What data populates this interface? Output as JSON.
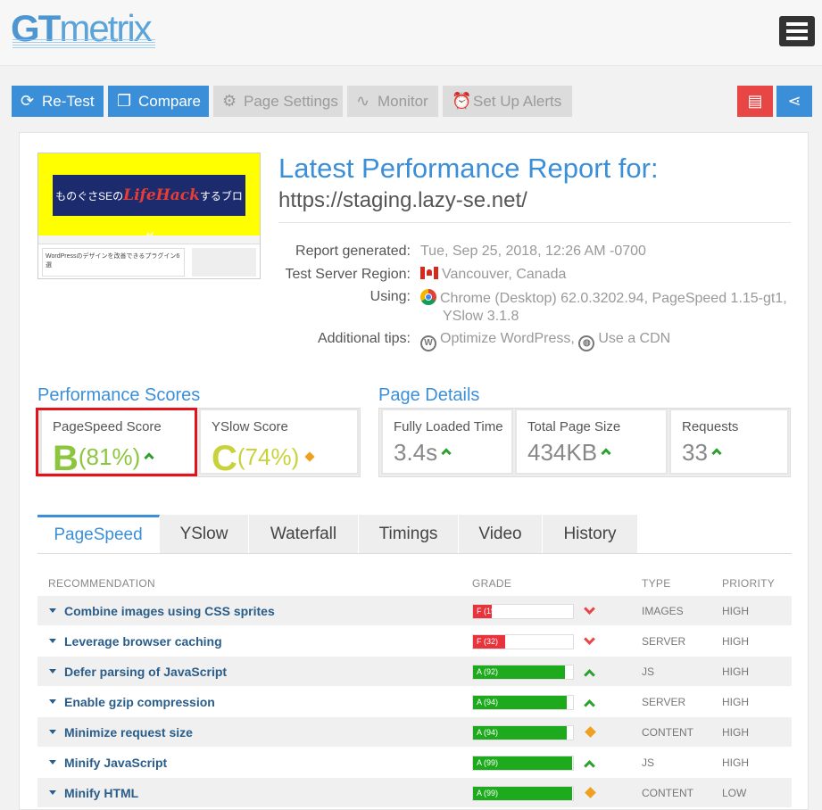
{
  "header": {
    "logo_gt": "GT",
    "logo_rest": "metrix",
    "menu_icon": "hamburger-menu-icon"
  },
  "toolbar": {
    "retest": "Re-Test",
    "compare": "Compare",
    "page_settings": "Page Settings",
    "monitor": "Monitor",
    "alerts": "Set Up Alerts",
    "pdf_icon": "pdf-icon",
    "share_icon": "share-icon",
    "accent": "#3b8fd8",
    "pdf_color": "#e84545"
  },
  "report": {
    "thumb_banner_pre": "ものぐさSEの",
    "thumb_banner_brand": "LifeHack",
    "thumb_banner_post": "するブログ",
    "thumb_post": "WordPressのデザインを改善できるプラグイン6選",
    "title": "Latest Performance Report for:",
    "url": "https://staging.lazy-se.net/",
    "generated_label": "Report generated:",
    "generated_value": "Tue, Sep 25, 2018, 12:26 AM -0700",
    "region_label": "Test Server Region:",
    "region_value": "Vancouver, Canada",
    "using_label": "Using:",
    "using_value_1": "Chrome (Desktop) 62.0.3202.94, PageSpeed 1.15-gt1,",
    "using_value_2": "YSlow 3.1.8",
    "tips_label": "Additional tips:",
    "tip_1": "Optimize WordPress,",
    "tip_2": "Use a CDN"
  },
  "scores": {
    "title": "Performance Scores",
    "pagespeed_label": "PageSpeed Score",
    "pagespeed_grade": "B",
    "pagespeed_pct": "(81%)",
    "yslow_label": "YSlow Score",
    "yslow_grade": "C",
    "yslow_pct": "(74%)",
    "pagespeed_color": "#8cc63f",
    "yslow_color": "#c8d23a"
  },
  "details": {
    "title": "Page Details",
    "loaded_label": "Fully Loaded Time",
    "loaded_value": "3.4s",
    "size_label": "Total Page Size",
    "size_value": "434KB",
    "requests_label": "Requests",
    "requests_value": "33"
  },
  "tabs": [
    "PageSpeed",
    "YSlow",
    "Waterfall",
    "Timings",
    "Video",
    "History"
  ],
  "table": {
    "headers": {
      "recommendation": "RECOMMENDATION",
      "grade": "GRADE",
      "type": "TYPE",
      "priority": "PRIORITY"
    },
    "rows": [
      {
        "rec": "Combine images using CSS sprites",
        "grade": "F (19)",
        "score": 19,
        "trend": "down",
        "type": "IMAGES",
        "priority": "HIGH"
      },
      {
        "rec": "Leverage browser caching",
        "grade": "F (32)",
        "score": 32,
        "trend": "down",
        "type": "SERVER",
        "priority": "HIGH"
      },
      {
        "rec": "Defer parsing of JavaScript",
        "grade": "A (92)",
        "score": 92,
        "trend": "up",
        "type": "JS",
        "priority": "HIGH"
      },
      {
        "rec": "Enable gzip compression",
        "grade": "A (94)",
        "score": 94,
        "trend": "up",
        "type": "SERVER",
        "priority": "HIGH"
      },
      {
        "rec": "Minimize request size",
        "grade": "A (94)",
        "score": 94,
        "trend": "neutral",
        "type": "CONTENT",
        "priority": "HIGH"
      },
      {
        "rec": "Minify JavaScript",
        "grade": "A (99)",
        "score": 99,
        "trend": "up",
        "type": "JS",
        "priority": "HIGH"
      },
      {
        "rec": "Minify HTML",
        "grade": "A (99)",
        "score": 99,
        "trend": "neutral",
        "type": "CONTENT",
        "priority": "LOW"
      }
    ]
  }
}
